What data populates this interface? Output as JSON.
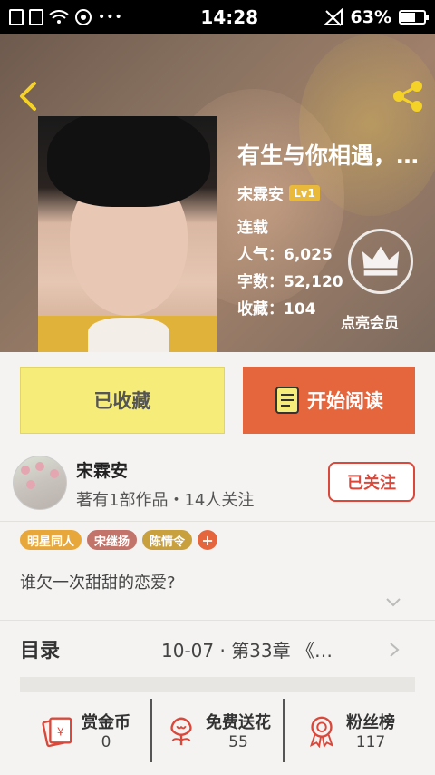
{
  "status_bar": {
    "time": "14:28",
    "battery": "63%",
    "battery_level": 0.63,
    "more": "•••"
  },
  "book": {
    "title": "有生与你相遇，…",
    "author": "宋霖安",
    "level": "Lv1",
    "status": "连载",
    "popularity": "人气：6,025",
    "word_count": "字数：52,120",
    "favorites": "收藏：104"
  },
  "vip": {
    "label": "点亮会员"
  },
  "actions": {
    "favorited_label": "已收藏",
    "read_label": "开始阅读"
  },
  "author_card": {
    "name": "宋霖安",
    "stats": "著有1部作品・14人关注",
    "follow_label": "已关注"
  },
  "tags": [
    {
      "label": "明星同人",
      "color": "#e8a73a"
    },
    {
      "label": "宋继扬",
      "color": "#c2746a"
    },
    {
      "label": "陈情令",
      "color": "#c8a03e"
    }
  ],
  "tag_add": "+",
  "description": "谁欠一次甜甜的恋爱?",
  "toc": {
    "label": "目录",
    "latest": "10-07 · 第33章 《…"
  },
  "bottom_stats": [
    {
      "label": "赏金币",
      "value": "0",
      "icon": "red-envelope-icon"
    },
    {
      "label": "免费送花",
      "value": "55",
      "icon": "flower-icon"
    },
    {
      "label": "粉丝榜",
      "value": "117",
      "icon": "medal-icon"
    }
  ],
  "colors": {
    "accent_orange": "#e5653d",
    "fav_yellow": "#f6ec79",
    "follow_red": "#d9483a",
    "icon_red": "#d9483a",
    "share_yellow": "#f5d228"
  }
}
